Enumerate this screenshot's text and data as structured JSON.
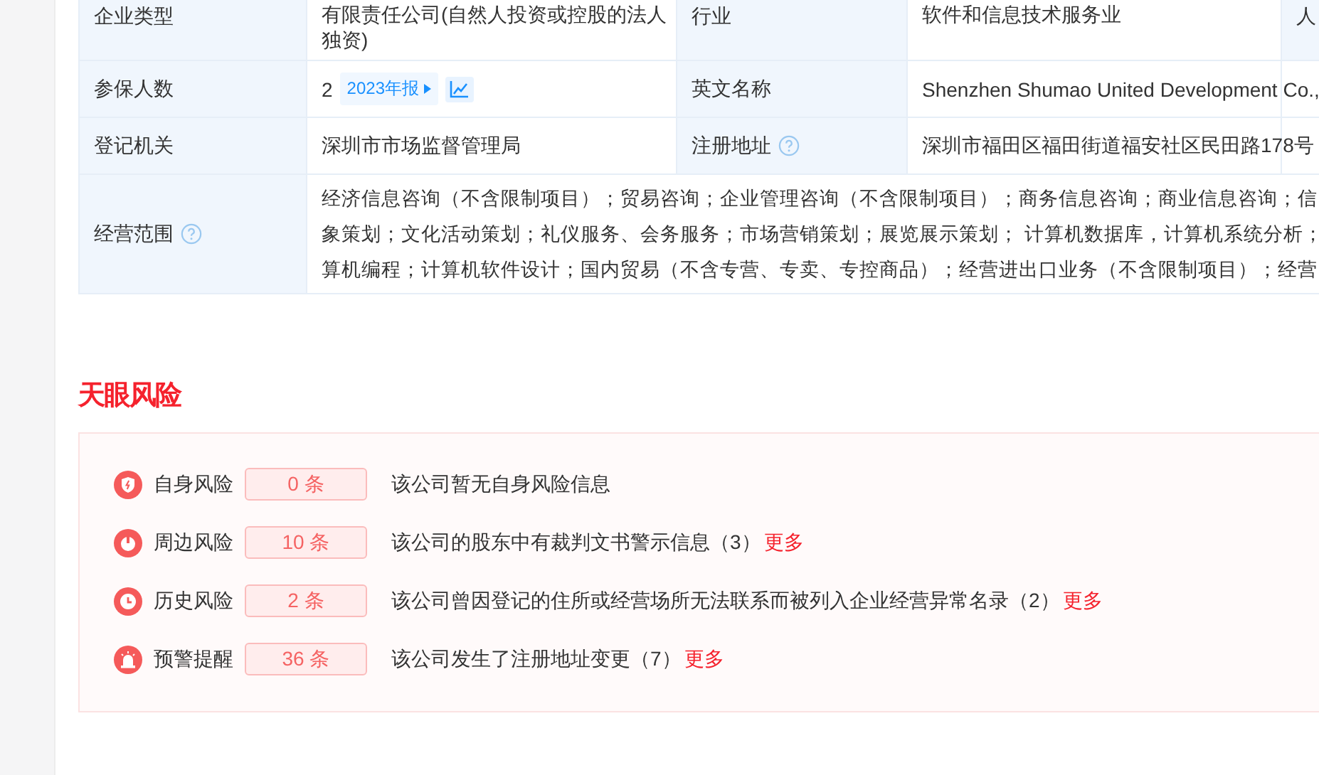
{
  "info_table": {
    "rows": [
      {
        "cells": [
          {
            "kind": "label",
            "text": "企业类型"
          },
          {
            "kind": "value",
            "lines": [
              "有限责任公司(自然人投资或控股的法人",
              "独资)"
            ]
          },
          {
            "kind": "label",
            "text": "行业"
          },
          {
            "kind": "value",
            "lines": [
              "软件和信息技术服务业"
            ]
          },
          {
            "kind": "label",
            "text": "人"
          }
        ]
      },
      {
        "cells": [
          {
            "kind": "label",
            "text": "参保人数"
          },
          {
            "kind": "insured",
            "text": "2",
            "report": "2023年报"
          },
          {
            "kind": "label",
            "text": "英文名称"
          },
          {
            "kind": "value",
            "lines": [
              "Shenzhen Shumao United Development Co.,"
            ]
          }
        ]
      },
      {
        "cells": [
          {
            "kind": "label",
            "text": "登记机关"
          },
          {
            "kind": "value",
            "lines": [
              "深圳市市场监督管理局"
            ]
          },
          {
            "kind": "label",
            "text": "注册地址",
            "help": true
          },
          {
            "kind": "value",
            "lines": [
              "深圳市福田区福田街道福安社区民田路178号"
            ]
          }
        ]
      },
      {
        "cells": [
          {
            "kind": "label",
            "text": "经营范围",
            "help": true
          },
          {
            "kind": "scope",
            "lines": [
              "经济信息咨询（不含限制项目）；贸易咨询；企业管理咨询（不含限制项目）；商务信息咨询；商业信息咨询；信",
              "象策划；文化活动策划；礼仪服务、会务服务；市场营销策划；展览展示策划； 计算机数据库，计算机系统分析；",
              "算机编程；计算机软件设计；国内贸易（不含专营、专卖、专控商品）；经营进出口业务（不含限制项目）；经营"
            ]
          }
        ]
      }
    ]
  },
  "risk": {
    "title": "天眼风险",
    "items": [
      {
        "kind": "shield",
        "label": "自身风险",
        "count": "0 条",
        "text": "该公司暂无自身风险信息"
      },
      {
        "kind": "power",
        "label": "周边风险",
        "count": "10 条",
        "text": "该公司的股东中有裁判文书警示信息（3）",
        "more": "更多"
      },
      {
        "kind": "clock",
        "label": "历史风险",
        "count": "2 条",
        "text": "该公司曾因登记的住所或经营场所无法联系而被列入企业经营异常名录（2）",
        "more": "更多"
      },
      {
        "kind": "alarm",
        "label": "预警提醒",
        "count": "36 条",
        "text": "该公司发生了注册地址变更（7）",
        "more": "更多"
      }
    ]
  }
}
